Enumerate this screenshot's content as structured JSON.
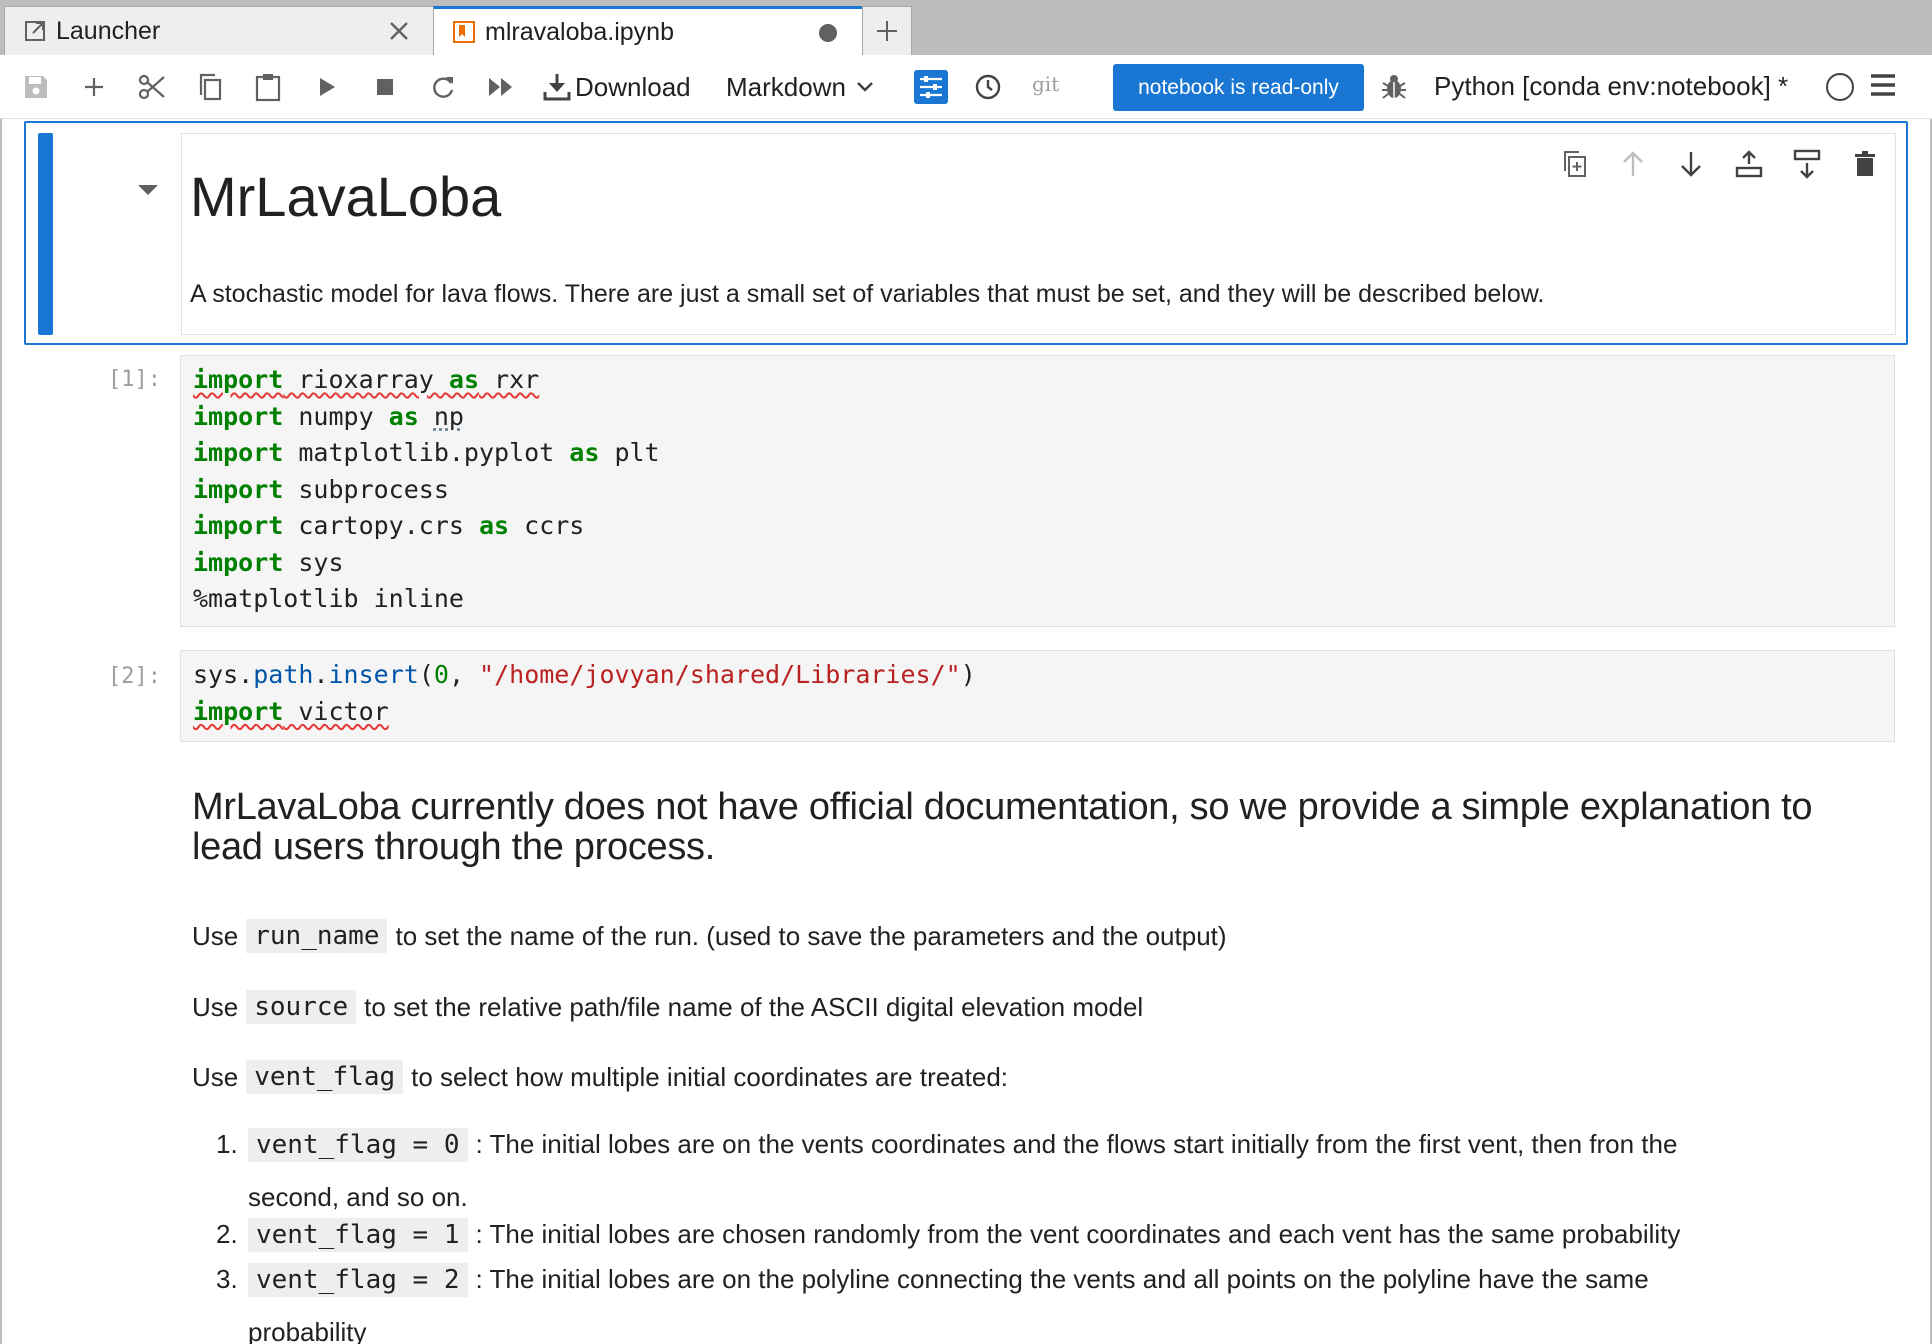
{
  "tabs": [
    {
      "label": "Launcher",
      "icon": "launcher-icon"
    },
    {
      "label": "mlravaloba.ipynb",
      "icon": "notebook-icon"
    }
  ],
  "toolbar": {
    "download_label": "Download",
    "cell_type": "Markdown",
    "git_label": "git",
    "readonly_label": "notebook is read-only",
    "kernel_label": "Python [conda env:notebook] *"
  },
  "cells": {
    "md1": {
      "title": "MrLavaLoba",
      "text": "A stochastic model for lava flows. There are just a small set of variables that must be set, and they will be described below."
    },
    "code1": {
      "prompt": "[1]:"
    },
    "code2": {
      "prompt": "[2]:"
    },
    "md2": {
      "heading": "MrLavaLoba currently does not have official documentation, so we provide a simple explanation to lead users through the process.",
      "p1_pre": "Use",
      "p1_code": "run_name",
      "p1_post": "to set the name of the run. (used to save the parameters and the output)",
      "p2_pre": "Use",
      "p2_code": "source",
      "p2_post": "to set the relative path/file name of the ASCII digital elevation model",
      "p3_pre": "Use",
      "p3_code": "vent_flag",
      "p3_post": "to select how multiple initial coordinates are treated:",
      "list": [
        {
          "num": "1.",
          "code": "vent_flag = 0",
          "text": ": The initial lobes are on the vents coordinates and the flows start initially from the first vent, then fron the",
          "cont": "second, and so on."
        },
        {
          "num": "2.",
          "code": "vent_flag = 1",
          "text": ": The initial lobes are chosen randomly from the vent coordinates and each vent has the same probability",
          "cont": ""
        },
        {
          "num": "3.",
          "code": "vent_flag = 2",
          "text": ": The initial lobes are on the polyline connecting the vents and all points on the polyline have the same",
          "cont": "probability"
        }
      ]
    }
  }
}
